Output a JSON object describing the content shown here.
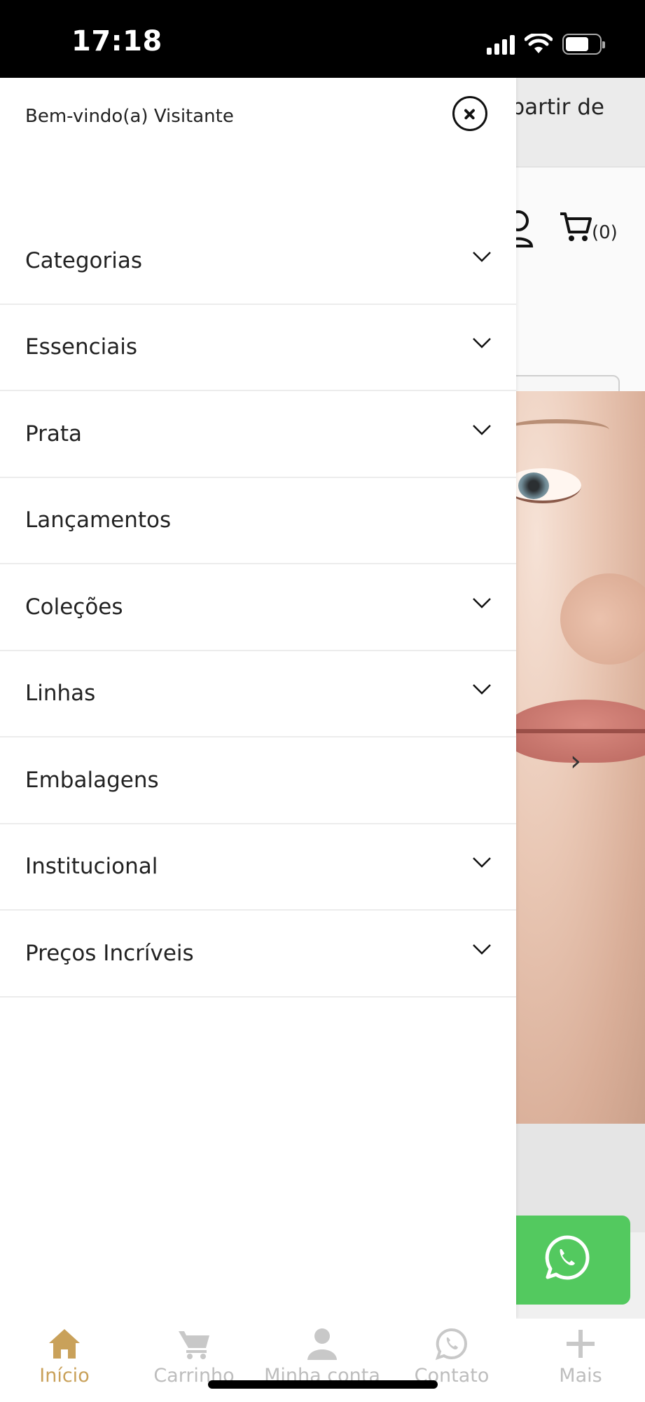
{
  "status_bar": {
    "time": "17:18"
  },
  "background_page": {
    "promo_text": "partir de",
    "cart_count": "(0)",
    "icons": [
      "account-icon",
      "cart-icon",
      "search-icon",
      "chevron-right-icon",
      "whatsapp-icon"
    ]
  },
  "drawer": {
    "welcome": "Bem-vindo(a) Visitante",
    "items": [
      {
        "label": "Categorias",
        "has_submenu": true
      },
      {
        "label": "Essenciais",
        "has_submenu": true
      },
      {
        "label": "Prata",
        "has_submenu": true
      },
      {
        "label": "Lançamentos",
        "has_submenu": false
      },
      {
        "label": "Coleções",
        "has_submenu": true
      },
      {
        "label": "Linhas",
        "has_submenu": true
      },
      {
        "label": "Embalagens",
        "has_submenu": false
      },
      {
        "label": "Institucional",
        "has_submenu": true
      },
      {
        "label": "Preços Incríveis",
        "has_submenu": true
      }
    ]
  },
  "tabbar": {
    "tabs": [
      {
        "label": "Início",
        "icon": "home-icon",
        "active": true
      },
      {
        "label": "Carrinho",
        "icon": "cart-icon",
        "active": false
      },
      {
        "label": "Minha conta",
        "icon": "user-icon",
        "active": false
      },
      {
        "label": "Contato",
        "icon": "whatsapp-icon",
        "active": false
      },
      {
        "label": "Mais",
        "icon": "plus-icon",
        "active": false
      }
    ]
  },
  "colors": {
    "accent": "#c9a15a",
    "whatsapp": "#53c95f",
    "inactive_tab": "#bdbdbd"
  }
}
